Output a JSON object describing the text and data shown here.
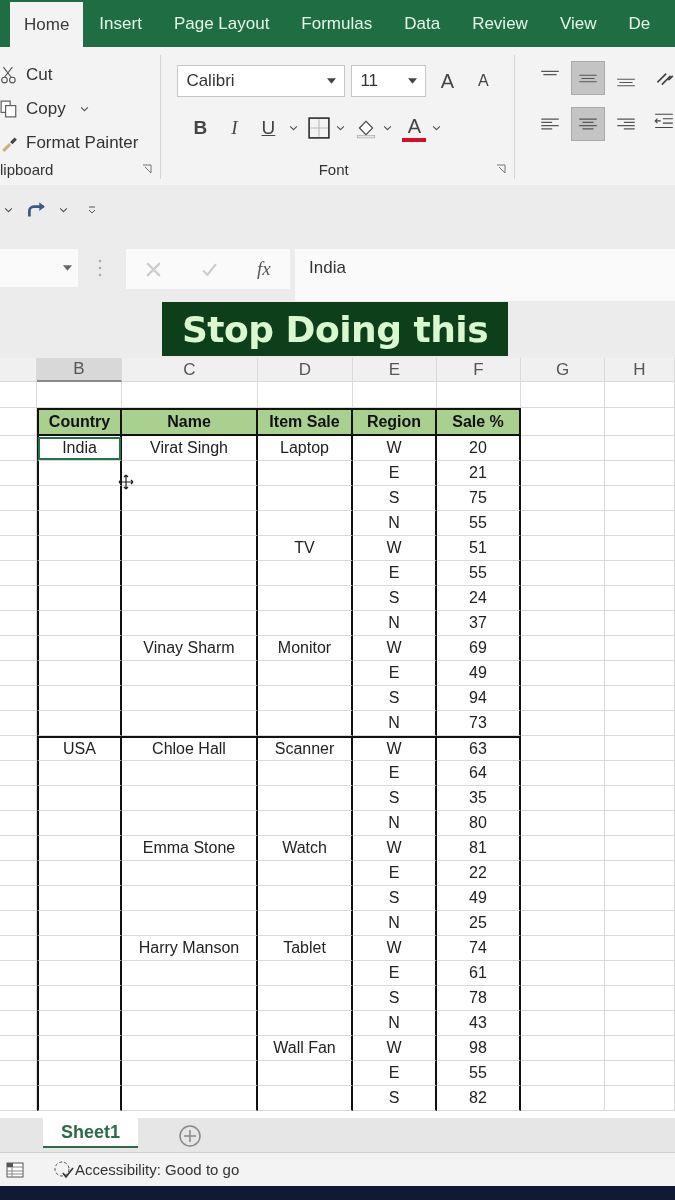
{
  "ribbon_tabs": [
    {
      "label": "Home",
      "selected": true
    },
    {
      "label": "Insert",
      "selected": false
    },
    {
      "label": "Page Layout",
      "selected": false
    },
    {
      "label": "Formulas",
      "selected": false
    },
    {
      "label": "Data",
      "selected": false
    },
    {
      "label": "Review",
      "selected": false
    },
    {
      "label": "View",
      "selected": false
    },
    {
      "label": "De",
      "selected": false
    }
  ],
  "clipboard": {
    "cut": "Cut",
    "copy": "Copy",
    "format_painter": "Format Painter",
    "label": "lipboard"
  },
  "font": {
    "family": "Calibri",
    "size": "11",
    "grow": "A",
    "shrink": "A",
    "bold": "B",
    "italic": "I",
    "underline": "U",
    "color_letter": "A",
    "label": "Font"
  },
  "alignment": [
    {
      "kind": "top",
      "selected": false
    },
    {
      "kind": "middle",
      "selected": true
    },
    {
      "kind": "bottom",
      "selected": false
    },
    {
      "kind": "left",
      "selected": false
    },
    {
      "kind": "center",
      "selected": true
    },
    {
      "kind": "right",
      "selected": false
    }
  ],
  "formula_bar": {
    "fx": "fx",
    "value": "India"
  },
  "caption": "Stop Doing this",
  "column_headers": [
    {
      "label": "B",
      "selected": true
    },
    {
      "label": "C",
      "selected": false
    },
    {
      "label": "D",
      "selected": false
    },
    {
      "label": "E",
      "selected": false
    },
    {
      "label": "F",
      "selected": false
    },
    {
      "label": "G",
      "selected": false
    },
    {
      "label": "H",
      "selected": false
    }
  ],
  "table": {
    "columns": [
      "Country",
      "Name",
      "Item Sale",
      "Region",
      "Sale %"
    ],
    "rows": [
      {
        "country": "India",
        "name": "Virat Singh",
        "item": "Laptop",
        "region": "W",
        "sale": "20",
        "country_selected": true
      },
      {
        "region": "E",
        "sale": "21",
        "country_selected": false
      },
      {
        "region": "S",
        "sale": "75",
        "country_selected": false
      },
      {
        "region": "N",
        "sale": "55",
        "country_selected": false
      },
      {
        "item": "TV",
        "region": "W",
        "sale": "51",
        "country_selected": false
      },
      {
        "region": "E",
        "sale": "55",
        "country_selected": false
      },
      {
        "region": "S",
        "sale": "24",
        "country_selected": false
      },
      {
        "region": "N",
        "sale": "37",
        "country_selected": false
      },
      {
        "name": "Vinay Sharm",
        "item": "Monitor",
        "region": "W",
        "sale": "69",
        "country_selected": false
      },
      {
        "region": "E",
        "sale": "49",
        "country_selected": false
      },
      {
        "region": "S",
        "sale": "94",
        "country_selected": false
      },
      {
        "region": "N",
        "sale": "73",
        "country_selected": false
      },
      {
        "country": "USA",
        "name": "Chloe Hall",
        "item": "Scanner",
        "region": "W",
        "sale": "63",
        "country_selected": false
      },
      {
        "region": "E",
        "sale": "64",
        "country_selected": false
      },
      {
        "region": "S",
        "sale": "35",
        "country_selected": false
      },
      {
        "region": "N",
        "sale": "80",
        "country_selected": false
      },
      {
        "name": "Emma Stone",
        "item": "Watch",
        "region": "W",
        "sale": "81",
        "country_selected": false
      },
      {
        "region": "E",
        "sale": "22",
        "country_selected": false
      },
      {
        "region": "S",
        "sale": "49",
        "country_selected": false
      },
      {
        "region": "N",
        "sale": "25",
        "country_selected": false
      },
      {
        "name": "Harry Manson",
        "item": "Tablet",
        "region": "W",
        "sale": "74",
        "country_selected": false
      },
      {
        "region": "E",
        "sale": "61",
        "country_selected": false
      },
      {
        "region": "S",
        "sale": "78",
        "country_selected": false
      },
      {
        "region": "N",
        "sale": "43",
        "country_selected": false
      },
      {
        "item": "Wall Fan",
        "region": "W",
        "sale": "98",
        "country_selected": false
      },
      {
        "region": "E",
        "sale": "55",
        "country_selected": false
      },
      {
        "region": "S",
        "sale": "82",
        "country_selected": false
      }
    ]
  },
  "sheet_tabs": [
    {
      "label": "Sheet1",
      "selected": true
    }
  ],
  "status": "Accessibility: Good to go"
}
